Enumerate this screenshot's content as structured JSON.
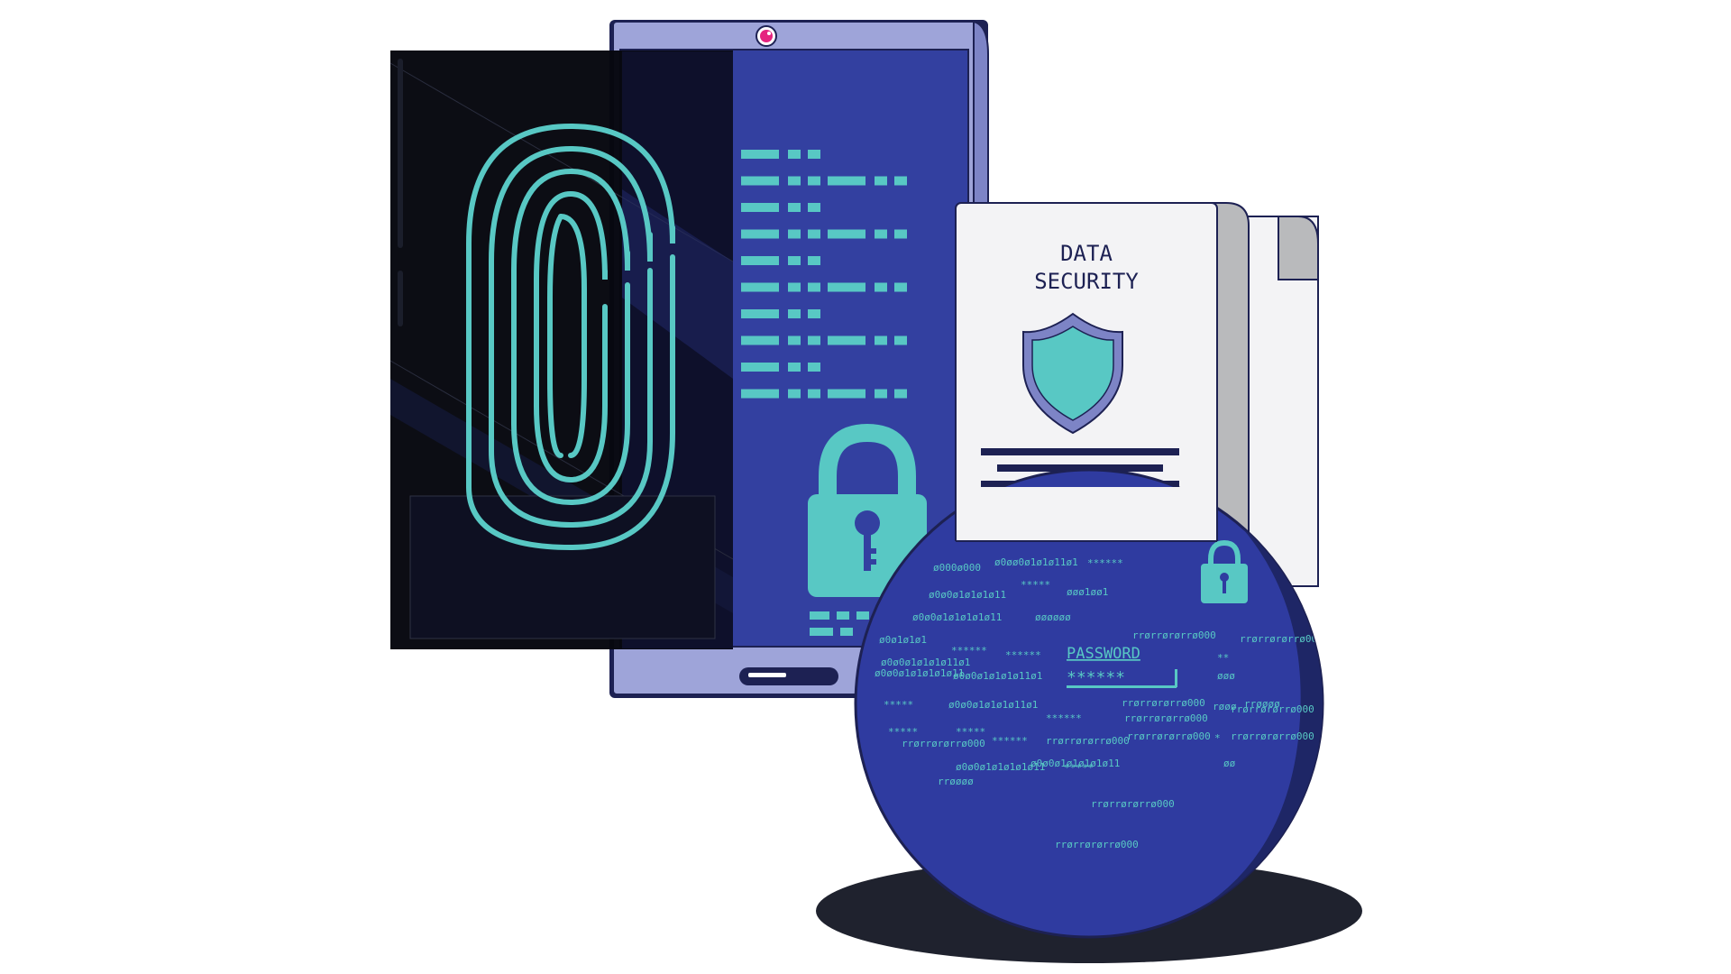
{
  "document": {
    "title_line1": "DATA",
    "title_line2": "SECURITY"
  },
  "globe": {
    "password_label": "PASSWORD",
    "password_mask": "******",
    "code_lines": [
      "ø000ø000",
      "ø0øø0ø1ø1ø11ø1",
      "******",
      "*****",
      "øøø1øø1",
      "ø0ø0ø1ø1ø1ø11",
      "ø0ø0ø1ø1ø1ø1ø11",
      "øøøøøø",
      "ø0ø1ø1ø1",
      "ø0ø0ø1ø1ø1ø11ø1",
      "rrørrørørrø000",
      "******",
      "******",
      "ø0ø0ø1ø1ø1ø11ø1",
      "ø0ø0ø1ø1ø1ø1ø11",
      "*****",
      "ø0ø0ø1ø1ø1ø11ø1",
      "*****",
      "*****",
      "rrørrørørrø000",
      "rrørrørørrø000",
      "rrørrørørrø000",
      "rrørrørørrø000",
      "rrørrørørrø000",
      "rrørrørørrø000",
      "rrøøøø",
      "******",
      "******",
      "rrørrørørrø000",
      "ø0ø0ø1ø1ø1ø1ø11",
      "ø0ø0ø1ø1ø1ø1ø11",
      "*****",
      "**",
      "øøø",
      "røøø",
      "*",
      "øø",
      "rrørrørørrø000",
      "rrøøøø",
      "rrørrørørrø000",
      "rrørrørørrø000"
    ]
  },
  "colors": {
    "tablet_frame": "#9ea4d9",
    "tablet_screen": "#3340a0",
    "teal": "#58c8c4",
    "navy": "#1d2153",
    "dark_panel": "#07080f",
    "paper": "#f3f3f5",
    "paper_shadow": "#b9babc",
    "globe": "#2f3ba0",
    "globe_shade": "#1e2666",
    "ground_shadow": "#1f222e",
    "camera": "#e5237f"
  },
  "icons": [
    "fingerprint-icon",
    "padlock-icon",
    "shield-icon",
    "small-padlock-icon"
  ]
}
